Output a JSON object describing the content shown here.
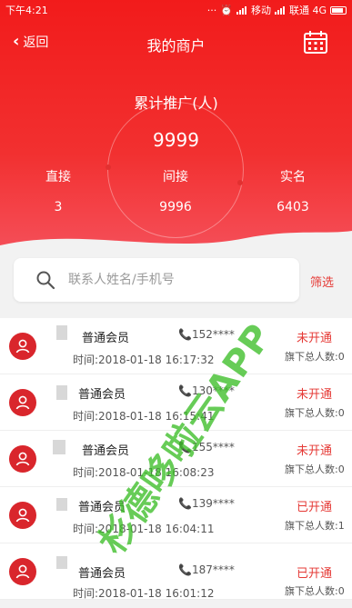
{
  "status_bar": {
    "time": "下午4:21",
    "carrier1": "移动",
    "carrier2": "联通 4G"
  },
  "nav": {
    "back_label": "返回",
    "title": "我的商户"
  },
  "summary": {
    "total_label": "累计推广(人)",
    "total_value": "9999",
    "stats": [
      {
        "label": "直接",
        "value": "3"
      },
      {
        "label": "间接",
        "value": "9996"
      },
      {
        "label": "实名",
        "value": "6403"
      }
    ]
  },
  "search": {
    "placeholder": "联系人姓名/手机号",
    "filter_label": "筛选"
  },
  "merchants": [
    {
      "level": "普通会员",
      "phone": "152****",
      "time": "时间:2018-01-18 16:17:32",
      "status": "未开通",
      "team": "旗下总人数:0"
    },
    {
      "level": "普通会员",
      "phone": "130****",
      "time": "时间:2018-01-18 16:15:41",
      "status": "未开通",
      "team": "旗下总人数:0"
    },
    {
      "level": "普通会员",
      "phone": "155****",
      "time": "时间:2018-01-18 16:08:23",
      "status": "未开通",
      "team": "旗下总人数:0"
    },
    {
      "level": "普通会员",
      "phone": "139****",
      "time": "时间:2018-01-18 16:04:11",
      "status": "已开通",
      "team": "旗下总人数:1"
    },
    {
      "level": "普通会员",
      "phone": "187****",
      "time": "时间:2018-01-18 16:01:12",
      "status": "已开通",
      "team": "旗下总人数:0"
    }
  ],
  "watermark": "杉德哆啦云APP",
  "colors": {
    "brand_red": "#f21b1b",
    "status_red": "#e53935",
    "watermark_green": "#3cbe28"
  }
}
